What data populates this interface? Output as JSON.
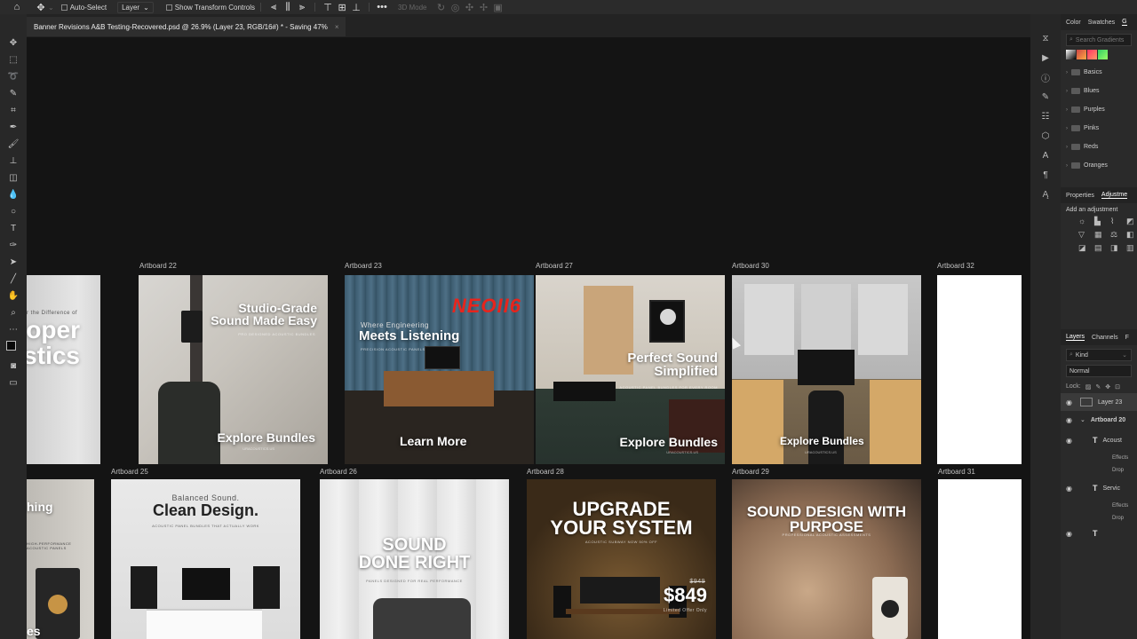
{
  "options_bar": {
    "auto_select_label": "Auto-Select",
    "layer_dropdown": "Layer",
    "show_transform_label": "Show Transform Controls",
    "mode_3d_label": "3D Mode"
  },
  "document_tab": {
    "title": "Banner Revisions A&B Testing-Recovered.psd @ 26.9% (Layer 23, RGB/16#) * - Saving 47%",
    "close": "×"
  },
  "artboards": {
    "left_top": {
      "title_top": "r the Difference of",
      "title_big": "oper\nstics"
    },
    "left_bottom": {
      "title": "hing",
      "sub": "HIGH-PERFORMANCE ACOUSTIC PANELS",
      "bottom": "es"
    },
    "ab22": {
      "label": "Artboard 22",
      "title": "Studio-Grade\nSound Made Easy",
      "sub": "PRO DESIGNED ACOUSTIC BUNDLES",
      "cta": "Explore Bundles",
      "brand": "URACOUSTICS.US"
    },
    "ab23": {
      "label": "Artboard 23",
      "logo": "NEOII6",
      "pre": "Where Engineering",
      "title": "Meets Listening",
      "sub": "PRECISION ACOUSTIC PANELS",
      "cta": "Learn More"
    },
    "ab27": {
      "label": "Artboard 27",
      "title": "Perfect Sound\nSimplified",
      "sub": "ACOUSTIC PANEL BUNDLES FOR EVERY ROOM",
      "cta": "Explore Bundles",
      "brand": "URACOUSTICS.US"
    },
    "ab30": {
      "label": "Artboard 30",
      "cta": "Explore Bundles",
      "brand": "URACOUSTICS.US"
    },
    "ab32": {
      "label": "Artboard 32"
    },
    "ab25": {
      "label": "Artboard 25",
      "pre": "Balanced Sound.",
      "title": "Clean Design.",
      "sub": "ACOUSTIC PANEL BUNDLES THAT ACTUALLY WORK"
    },
    "ab26": {
      "label": "Artboard 26",
      "title": "SOUND\nDONE RIGHT",
      "sub": "PANELS DESIGNED FOR REAL PERFORMANCE"
    },
    "ab28": {
      "label": "Artboard 28",
      "title": "UPGRADE\nYOUR SYSTEM",
      "sub": "ACOUSTIC SUBWAY NOW 50% OFF",
      "old_price": "$949",
      "price": "$849",
      "offer": "Limited Offer Only"
    },
    "ab29": {
      "label": "Artboard 29",
      "title": "SOUND DESIGN WITH\nPURPOSE",
      "sub": "PROFESSIONAL ACOUSTIC ASSESSMENTS"
    },
    "ab31": {
      "label": "Artboard 31"
    }
  },
  "gradients_panel": {
    "tabs": [
      "Color",
      "Swatches",
      "G"
    ],
    "search_placeholder": "Search Gradients",
    "folders": [
      "Basics",
      "Blues",
      "Purples",
      "Pinks",
      "Reds",
      "Oranges"
    ]
  },
  "properties_panel": {
    "tabs": [
      "Properties",
      "Adjustme"
    ],
    "hint": "Add an adjustment"
  },
  "layers_panel": {
    "tabs": [
      "Layers",
      "Channels",
      "F"
    ],
    "kind_label": "Kind",
    "blend_mode": "Normal",
    "lock_label": "Lock:",
    "layer23": "Layer 23",
    "artboard20": "Artboard 20",
    "text1": "Acoust",
    "effects": "Effects",
    "drop": "Drop",
    "text2": "Servic"
  },
  "colors": {
    "canvas": "#141414",
    "panel": "#2a2a2a",
    "accent_red": "#e8241c"
  }
}
